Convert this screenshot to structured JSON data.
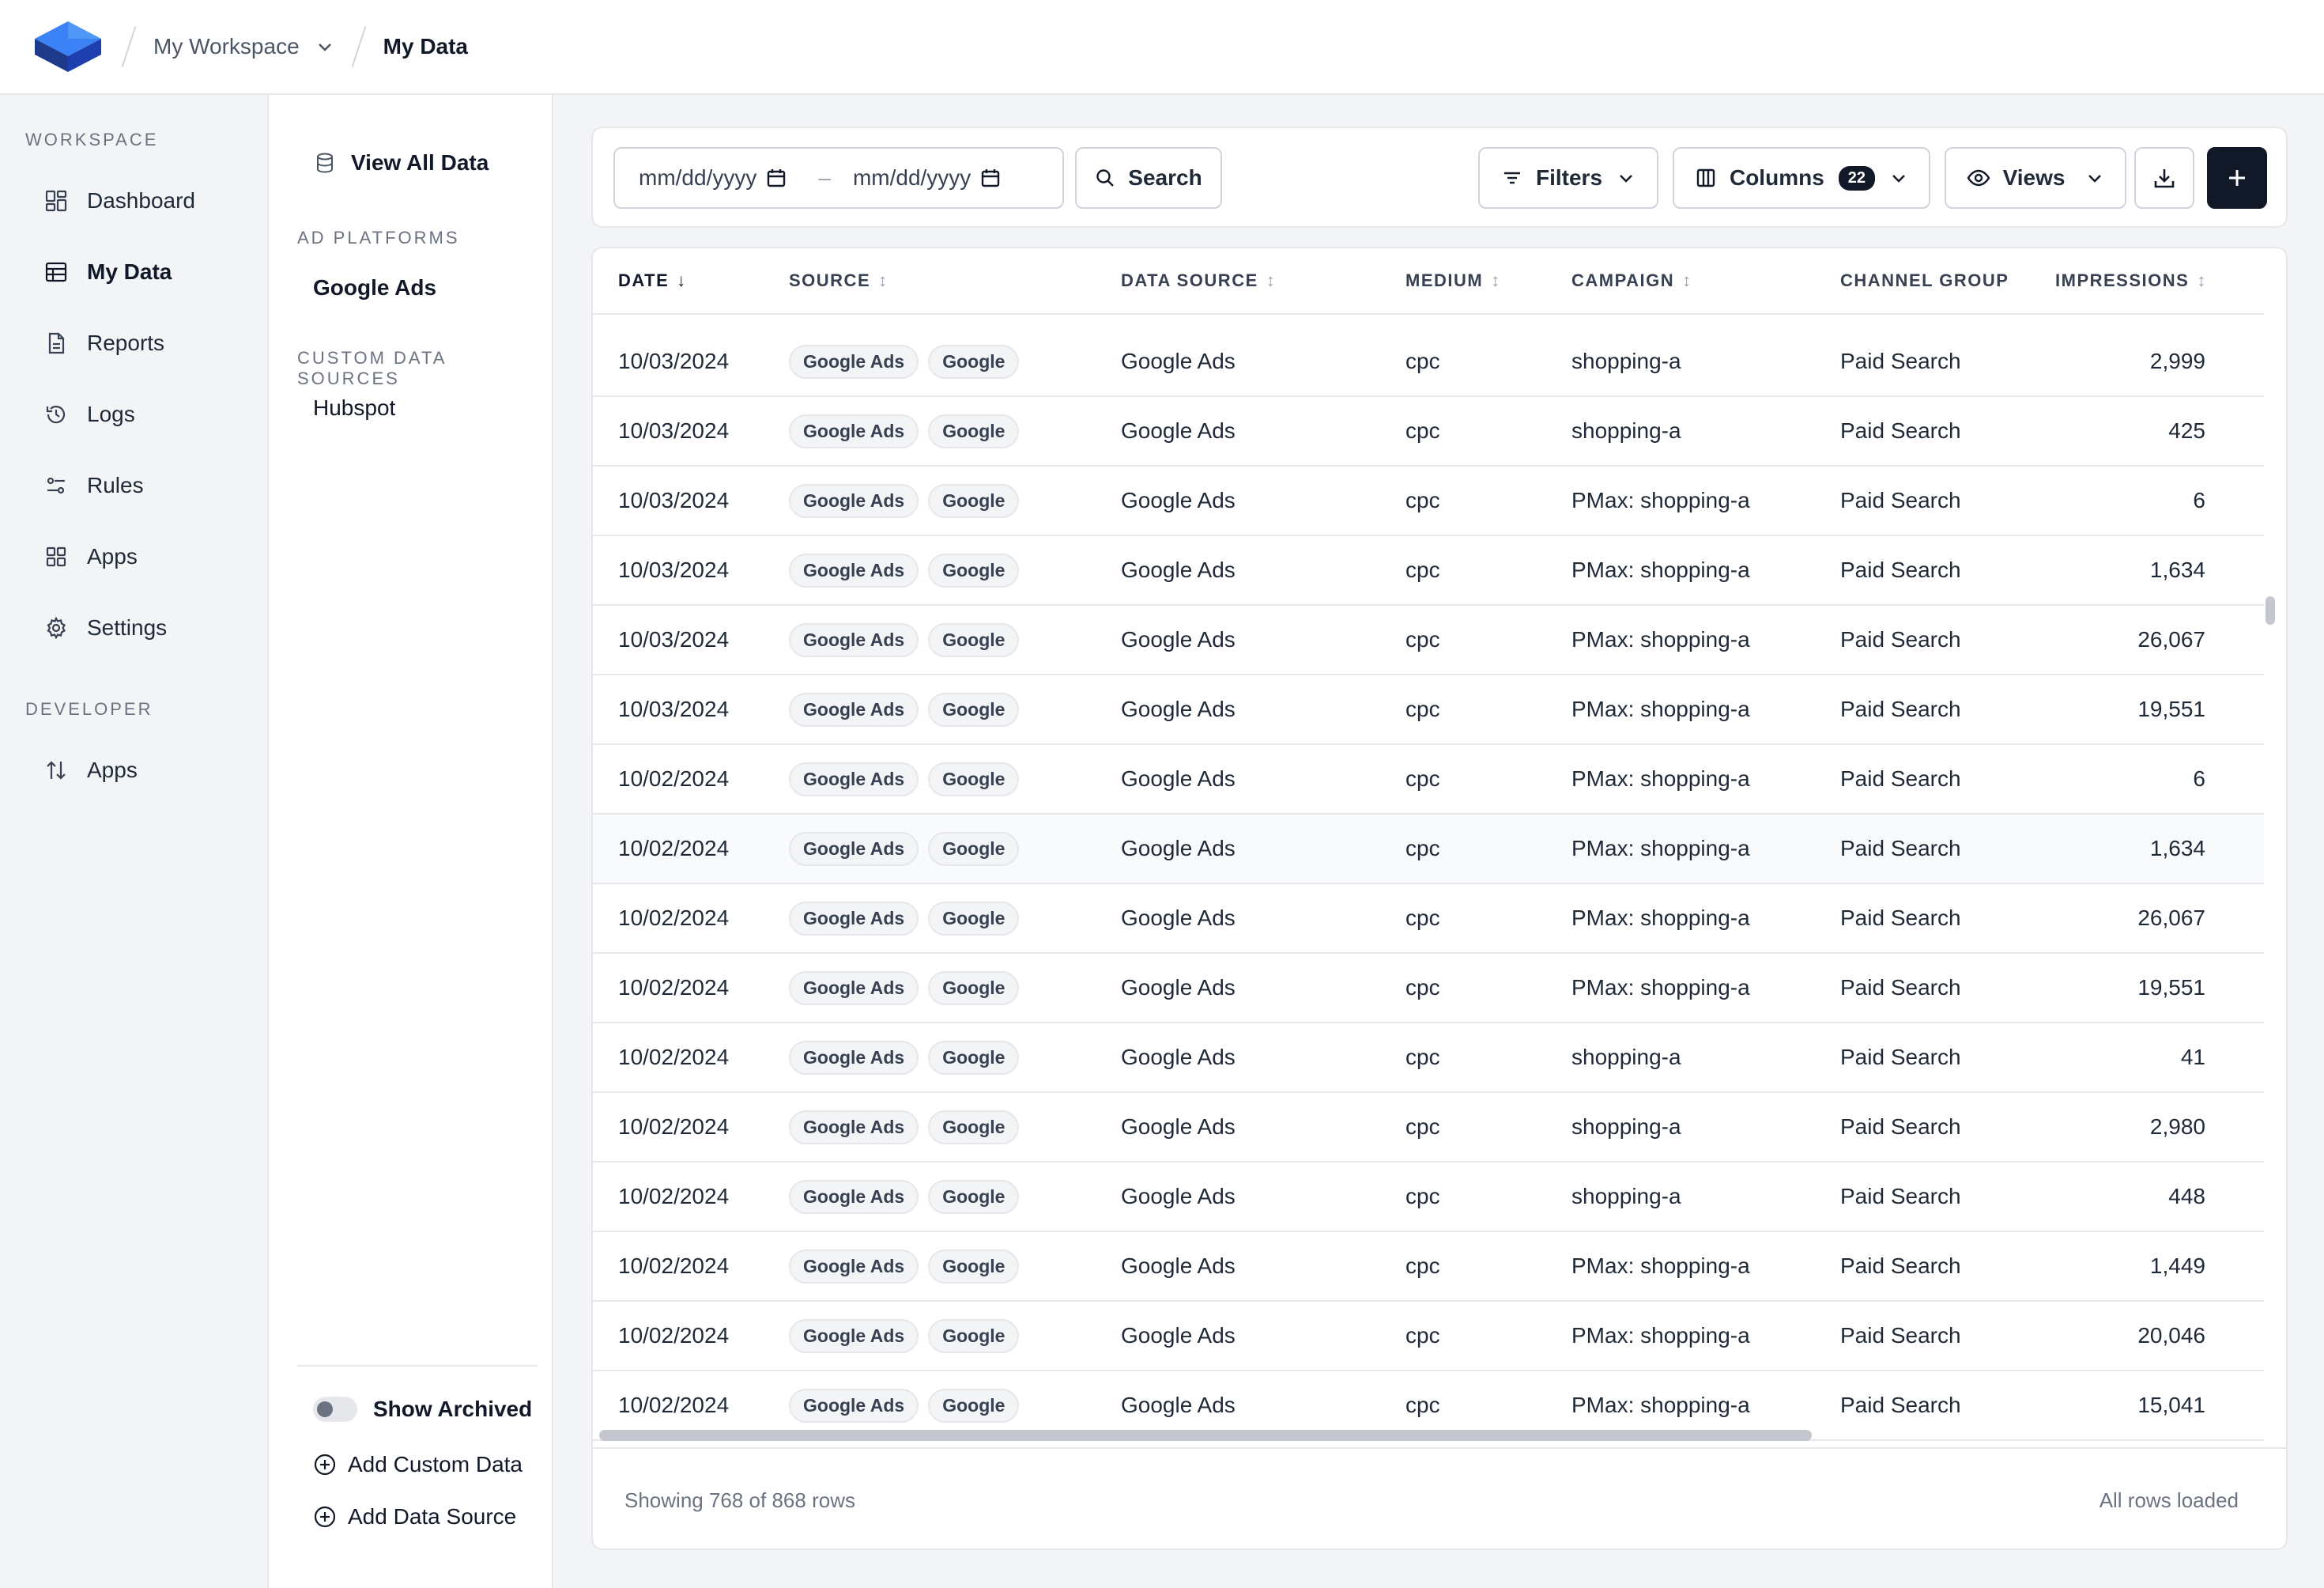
{
  "header": {
    "workspace": "My Workspace",
    "current_page": "My Data"
  },
  "sidebar": {
    "workspace_title": "WORKSPACE",
    "items": [
      {
        "label": "Dashboard",
        "icon": "dashboard-icon"
      },
      {
        "label": "My Data",
        "icon": "table-icon",
        "active": true
      },
      {
        "label": "Reports",
        "icon": "document-icon"
      },
      {
        "label": "Logs",
        "icon": "history-icon"
      },
      {
        "label": "Rules",
        "icon": "rules-icon"
      },
      {
        "label": "Apps",
        "icon": "grid-icon"
      },
      {
        "label": "Settings",
        "icon": "gear-icon"
      }
    ],
    "developer_title": "DEVELOPER",
    "developer_items": [
      {
        "label": "Apps",
        "icon": "arrows-updown-icon"
      }
    ]
  },
  "data_panel": {
    "view_all": "View All Data",
    "ad_platforms_title": "AD PLATFORMS",
    "ad_platforms": [
      "Google Ads"
    ],
    "custom_title": "CUSTOM DATA SOURCES",
    "custom_sources": [
      "Hubspot"
    ],
    "show_archived": "Show Archived",
    "add_custom": "Add Custom Data",
    "add_source": "Add Data Source"
  },
  "toolbar": {
    "date_start_placeholder": "mm/dd/yyyy",
    "date_end_placeholder": "mm/dd/yyyy",
    "date_separator": "–",
    "search_label": "Search",
    "filters_label": "Filters",
    "columns_label": "Columns",
    "columns_count": "22",
    "views_label": "Views"
  },
  "table": {
    "columns": [
      "DATE",
      "SOURCE",
      "DATA SOURCE",
      "MEDIUM",
      "CAMPAIGN",
      "CHANNEL GROUP",
      "IMPRESSIONS"
    ],
    "rows": [
      {
        "date": "10/03/2024",
        "tags": [
          "Google Ads",
          "Google"
        ],
        "data_source": "Google Ads",
        "medium": "cpc",
        "campaign": "shopping-a",
        "channel": "Paid Search",
        "impressions": "2,999"
      },
      {
        "date": "10/03/2024",
        "tags": [
          "Google Ads",
          "Google"
        ],
        "data_source": "Google Ads",
        "medium": "cpc",
        "campaign": "shopping-a",
        "channel": "Paid Search",
        "impressions": "425"
      },
      {
        "date": "10/03/2024",
        "tags": [
          "Google Ads",
          "Google"
        ],
        "data_source": "Google Ads",
        "medium": "cpc",
        "campaign": "PMax: shopping-a",
        "channel": "Paid Search",
        "impressions": "6"
      },
      {
        "date": "10/03/2024",
        "tags": [
          "Google Ads",
          "Google"
        ],
        "data_source": "Google Ads",
        "medium": "cpc",
        "campaign": "PMax: shopping-a",
        "channel": "Paid Search",
        "impressions": "1,634"
      },
      {
        "date": "10/03/2024",
        "tags": [
          "Google Ads",
          "Google"
        ],
        "data_source": "Google Ads",
        "medium": "cpc",
        "campaign": "PMax: shopping-a",
        "channel": "Paid Search",
        "impressions": "26,067"
      },
      {
        "date": "10/03/2024",
        "tags": [
          "Google Ads",
          "Google"
        ],
        "data_source": "Google Ads",
        "medium": "cpc",
        "campaign": "PMax: shopping-a",
        "channel": "Paid Search",
        "impressions": "19,551"
      },
      {
        "date": "10/02/2024",
        "tags": [
          "Google Ads",
          "Google"
        ],
        "data_source": "Google Ads",
        "medium": "cpc",
        "campaign": "PMax: shopping-a",
        "channel": "Paid Search",
        "impressions": "6"
      },
      {
        "date": "10/02/2024",
        "tags": [
          "Google Ads",
          "Google"
        ],
        "data_source": "Google Ads",
        "medium": "cpc",
        "campaign": "PMax: shopping-a",
        "channel": "Paid Search",
        "impressions": "1,634",
        "highlighted": true
      },
      {
        "date": "10/02/2024",
        "tags": [
          "Google Ads",
          "Google"
        ],
        "data_source": "Google Ads",
        "medium": "cpc",
        "campaign": "PMax: shopping-a",
        "channel": "Paid Search",
        "impressions": "26,067"
      },
      {
        "date": "10/02/2024",
        "tags": [
          "Google Ads",
          "Google"
        ],
        "data_source": "Google Ads",
        "medium": "cpc",
        "campaign": "PMax: shopping-a",
        "channel": "Paid Search",
        "impressions": "19,551"
      },
      {
        "date": "10/02/2024",
        "tags": [
          "Google Ads",
          "Google"
        ],
        "data_source": "Google Ads",
        "medium": "cpc",
        "campaign": "shopping-a",
        "channel": "Paid Search",
        "impressions": "41"
      },
      {
        "date": "10/02/2024",
        "tags": [
          "Google Ads",
          "Google"
        ],
        "data_source": "Google Ads",
        "medium": "cpc",
        "campaign": "shopping-a",
        "channel": "Paid Search",
        "impressions": "2,980"
      },
      {
        "date": "10/02/2024",
        "tags": [
          "Google Ads",
          "Google"
        ],
        "data_source": "Google Ads",
        "medium": "cpc",
        "campaign": "shopping-a",
        "channel": "Paid Search",
        "impressions": "448"
      },
      {
        "date": "10/02/2024",
        "tags": [
          "Google Ads",
          "Google"
        ],
        "data_source": "Google Ads",
        "medium": "cpc",
        "campaign": "PMax: shopping-a",
        "channel": "Paid Search",
        "impressions": "1,449"
      },
      {
        "date": "10/02/2024",
        "tags": [
          "Google Ads",
          "Google"
        ],
        "data_source": "Google Ads",
        "medium": "cpc",
        "campaign": "PMax: shopping-a",
        "channel": "Paid Search",
        "impressions": "20,046"
      },
      {
        "date": "10/02/2024",
        "tags": [
          "Google Ads",
          "Google"
        ],
        "data_source": "Google Ads",
        "medium": "cpc",
        "campaign": "PMax: shopping-a",
        "channel": "Paid Search",
        "impressions": "15,041"
      }
    ],
    "footer_left": "Showing 768 of 868 rows",
    "footer_right": "All rows loaded"
  },
  "colors": {
    "accent": "#111827",
    "logo_blue": "#3b82f6"
  }
}
